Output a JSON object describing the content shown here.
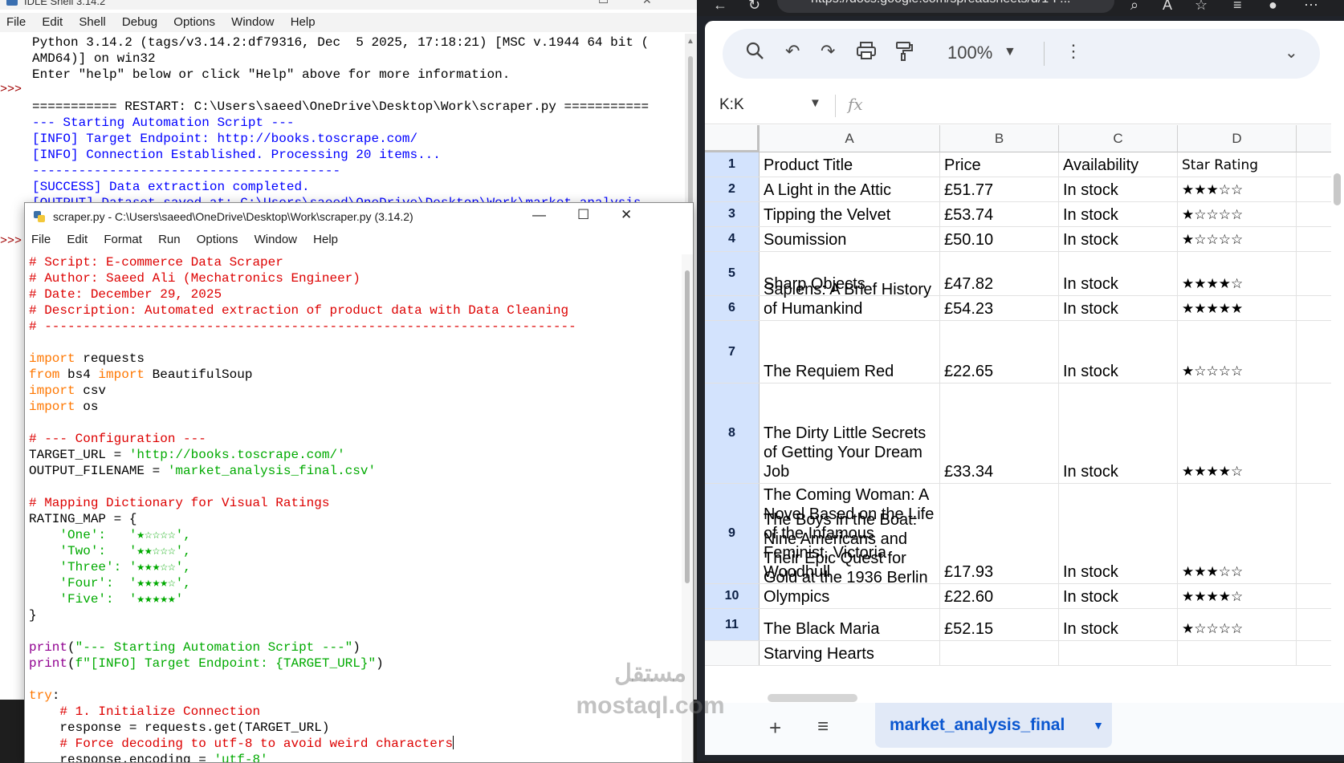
{
  "shell": {
    "title": "IDLE Shell 3.14.2",
    "menu": [
      "File",
      "Edit",
      "Shell",
      "Debug",
      "Options",
      "Window",
      "Help"
    ],
    "prompt": ">>>",
    "lines": [
      {
        "text": "Python 3.14.2 (tags/v3.14.2:df79316, Dec  5 2025, 17:18:21) [MSC v.1944 64 bit (",
        "color": "black"
      },
      {
        "text": "AMD64)] on win32",
        "color": "black"
      },
      {
        "text": "Enter \"help\" below or click \"Help\" above for more information.",
        "color": "black"
      },
      {
        "text": "",
        "color": "black"
      },
      {
        "text": "=========== RESTART: C:\\Users\\saeed\\OneDrive\\Desktop\\Work\\scraper.py ===========",
        "color": "black"
      },
      {
        "text": "--- Starting Automation Script ---",
        "color": "blue"
      },
      {
        "text": "[INFO] Target Endpoint: http://books.toscrape.com/",
        "color": "blue"
      },
      {
        "text": "[INFO] Connection Established. Processing 20 items...",
        "color": "blue"
      },
      {
        "text": "----------------------------------------",
        "color": "blue"
      },
      {
        "text": "[SUCCESS] Data extraction completed.",
        "color": "blue"
      },
      {
        "text": "[OUTPUT] Dataset saved at: C:\\Users\\saeed\\OneDrive\\Desktop\\Work\\market_analysis",
        "color": "blue"
      }
    ]
  },
  "editor": {
    "title": "scraper.py - C:\\Users\\saeed\\OneDrive\\Desktop\\Work\\scraper.py (3.14.2)",
    "menu": [
      "File",
      "Edit",
      "Format",
      "Run",
      "Options",
      "Window",
      "Help"
    ],
    "code": [
      [
        [
          "cm",
          "# Script: E-commerce Data Scraper"
        ]
      ],
      [
        [
          "cm",
          "# Author: Saeed Ali (Mechatronics Engineer)"
        ]
      ],
      [
        [
          "cm",
          "# Date: December 29, 2025"
        ]
      ],
      [
        [
          "cm",
          "# Description: Automated extraction of product data with Data Cleaning"
        ]
      ],
      [
        [
          "cm",
          "# ---------------------------------------------------------------------"
        ]
      ],
      [],
      [
        [
          "kw",
          "import"
        ],
        [
          "",
          " requests"
        ]
      ],
      [
        [
          "kw",
          "from"
        ],
        [
          "",
          " bs4 "
        ],
        [
          "kw",
          "import"
        ],
        [
          "",
          " BeautifulSoup"
        ]
      ],
      [
        [
          "kw",
          "import"
        ],
        [
          "",
          " csv"
        ]
      ],
      [
        [
          "kw",
          "import"
        ],
        [
          "",
          " os"
        ]
      ],
      [],
      [
        [
          "cm",
          "# --- Configuration ---"
        ]
      ],
      [
        [
          "",
          "TARGET_URL = "
        ],
        [
          "st",
          "'http://books.toscrape.com/'"
        ]
      ],
      [
        [
          "",
          "OUTPUT_FILENAME = "
        ],
        [
          "st",
          "'market_analysis_final.csv'"
        ]
      ],
      [],
      [
        [
          "cm",
          "# Mapping Dictionary for Visual Ratings"
        ]
      ],
      [
        [
          "",
          "RATING_MAP = {"
        ]
      ],
      [
        [
          "",
          "    "
        ],
        [
          "st",
          "'One':   '★☆☆☆☆',"
        ]
      ],
      [
        [
          "",
          "    "
        ],
        [
          "st",
          "'Two':   '★★☆☆☆',"
        ]
      ],
      [
        [
          "",
          "    "
        ],
        [
          "st",
          "'Three': '★★★☆☆',"
        ]
      ],
      [
        [
          "",
          "    "
        ],
        [
          "st",
          "'Four':  '★★★★☆',"
        ]
      ],
      [
        [
          "",
          "    "
        ],
        [
          "st",
          "'Five':  '★★★★★'"
        ]
      ],
      [
        [
          "",
          "}"
        ]
      ],
      [],
      [
        [
          "bi",
          "print"
        ],
        [
          "",
          "("
        ],
        [
          "st",
          "\"--- Starting Automation Script ---\""
        ],
        [
          "",
          ")"
        ]
      ],
      [
        [
          "bi",
          "print"
        ],
        [
          "",
          "("
        ],
        [
          "st",
          "f\"[INFO] Target Endpoint: {TARGET_URL}\""
        ],
        [
          "",
          ")"
        ]
      ],
      [],
      [
        [
          "kw",
          "try"
        ],
        [
          "",
          ":"
        ]
      ],
      [
        [
          "",
          "    "
        ],
        [
          "cm",
          "# 1. Initialize Connection"
        ]
      ],
      [
        [
          "",
          "    response = requests.get(TARGET_URL)"
        ]
      ],
      [
        [
          "",
          "    "
        ],
        [
          "cm",
          "# Force decoding to utf-8 to avoid weird characters"
        ],
        [
          "cursor",
          ""
        ]
      ],
      [
        [
          "",
          "    response.encoding = "
        ],
        [
          "st",
          "'utf-8'"
        ]
      ]
    ]
  },
  "browser": {
    "url": "https://docs.google.com/spreadsheets/d/1-P..."
  },
  "sheets": {
    "zoom": "100%",
    "name_box": "K:K",
    "fx": "fx",
    "columns": [
      "A",
      "B",
      "C",
      "D"
    ],
    "rows": [
      {
        "num": "1",
        "cells": [
          "Product Title",
          "Price",
          "Availability",
          "Star Rating"
        ]
      },
      {
        "num": "2",
        "cells": [
          "A Light in the Attic",
          "£51.77",
          "In stock",
          "★★★☆☆"
        ]
      },
      {
        "num": "3",
        "cells": [
          "Tipping the Velvet",
          "£53.74",
          "In stock",
          "★☆☆☆☆"
        ]
      },
      {
        "num": "4",
        "cells": [
          "Soumission",
          "£50.10",
          "In stock",
          "★☆☆☆☆"
        ]
      },
      {
        "num": "5",
        "cells": [
          "Sharp Objects",
          "£47.82",
          "In stock",
          "★★★★☆"
        ]
      },
      {
        "num": "6",
        "cells": [
          "Sapiens: A Brief History of Humankind",
          "£54.23",
          "In stock",
          "★★★★★"
        ]
      },
      {
        "num": "7",
        "cells": [
          "The Requiem Red",
          "£22.65",
          "In stock",
          "★☆☆☆☆"
        ]
      },
      {
        "num": "8",
        "cells": [
          "The Dirty Little Secrets of Getting Your Dream Job",
          "£33.34",
          "In stock",
          "★★★★☆"
        ]
      },
      {
        "num": "9",
        "cells": [
          "The Coming Woman: A Novel Based on the Life of the Infamous Feminist, Victoria Woodhull",
          "£17.93",
          "In stock",
          "★★★☆☆"
        ]
      },
      {
        "num": "10",
        "cells": [
          "The Boys in the Boat: Nine Americans and Their Epic Quest for Gold at the 1936 Berlin Olympics",
          "£22.60",
          "In stock",
          "★★★★☆"
        ]
      },
      {
        "num": "11",
        "cells": [
          "The Black Maria",
          "£52.15",
          "In stock",
          "★☆☆☆☆"
        ]
      },
      {
        "num": "",
        "cells": [
          "Starving Hearts",
          "",
          "",
          ""
        ]
      }
    ],
    "sheet_tab": "market_analysis_final"
  },
  "watermark": {
    "arabic": "مستقل",
    "latin": "mostaql.com"
  }
}
